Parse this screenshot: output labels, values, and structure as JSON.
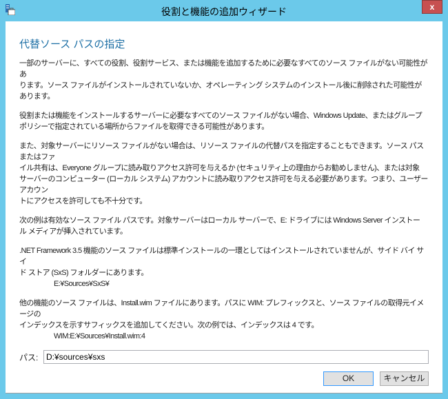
{
  "window": {
    "title": "役割と機能の追加ウィザード",
    "close_label": "x"
  },
  "heading": "代替ソース パスの指定",
  "paragraphs": [
    [
      "一部のサーバーに、すべての役割、役割サービス、または機能を追加するために必要なすべてのソース ファイルがない可能性があ",
      "ります。ソース ファイルがインストールされていないか、オペレーティング システムのインストール後に削除された可能性があります。"
    ],
    [
      "役割または機能をインストールするサーバーに必要なすべてのソース ファイルがない場合、Windows Update、またはグループ",
      "ポリシーで指定されている場所からファイルを取得できる可能性があります。"
    ],
    [
      "また、対象サーバーにリソース ファイルがない場合は、リソース ファイルの代替パスを指定することもできます。ソース パスまたはファ",
      "イル共有は、Everyone グループに読み取りアクセス許可を与えるか (セキュリティ上の理由からお勧めしません)、または対象",
      "サーバーのコンピューター (ローカル システム) アカウントに読み取りアクセス許可を与える必要があります。つまり、ユーザー アカウン",
      "トにアクセスを許可しても不十分です。"
    ],
    [
      "次の例は有効なソース ファイル パスです。対象サーバーはローカル サーバーで、E: ドライブには Windows Server インストー",
      "ル メディアが挿入されています。"
    ],
    [
      ".NET Framework 3.5 機能のソース ファイルは標準インストールの一環としてはインストールされていませんが、サイド バイ サイ",
      "ド ストア (SxS) フォルダーにあります。"
    ],
    [
      "他の機能のソース ファイルは、Install.wim ファイルにあります。パスに WIM: プレフィックスと、ソース ファイルの取得元イメージの",
      "インデックスを示すサフィックスを追加してください。次の例では、インデックスは 4 です。"
    ]
  ],
  "examples": {
    "sxs": "E:¥Sources¥SxS¥",
    "wim": "WIM:E:¥Sources¥Install.wim:4"
  },
  "path": {
    "label": "パス:",
    "value": "D:¥sources¥sxs"
  },
  "buttons": {
    "ok": "OK",
    "cancel": "キャンセル"
  }
}
